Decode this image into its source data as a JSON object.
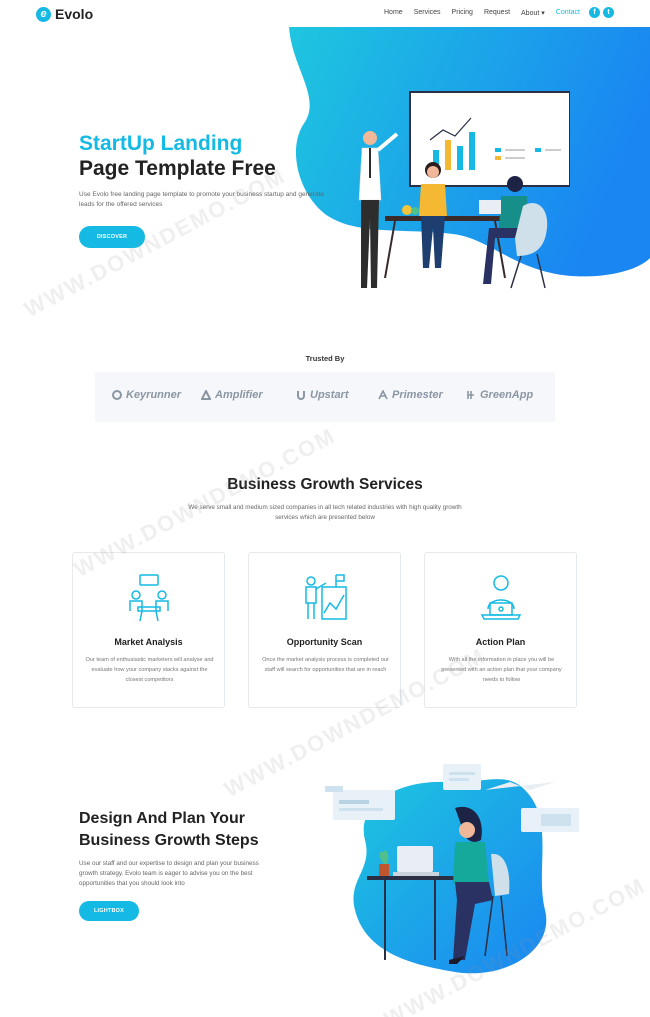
{
  "nav": {
    "logo_letter": "e",
    "brand": "Evolo",
    "items": [
      {
        "label": "Home"
      },
      {
        "label": "Services"
      },
      {
        "label": "Pricing"
      },
      {
        "label": "Request"
      },
      {
        "label": "About ▾"
      },
      {
        "label": "Contact"
      }
    ],
    "social": [
      "f",
      "t"
    ]
  },
  "hero": {
    "title_line1": "StartUp Landing",
    "title_line2": "Page Template Free",
    "description": "Use Evolo free landing page template to promote your business startup and generate leads for the offered services",
    "button": "DISCOVER"
  },
  "trusted": {
    "title": "Trusted By",
    "brands": [
      "Keyrunner",
      "Amplifier",
      "Upstart",
      "Primester",
      "GreenApp"
    ]
  },
  "services": {
    "title": "Business Growth Services",
    "description": "We serve small and medium sized companies in all tech related industries with high quality growth services which are presented below",
    "cards": [
      {
        "title": "Market Analysis",
        "text": "Our team of enthusiastic marketers will analyse and evaluate how your company stacks against the closest competitors"
      },
      {
        "title": "Opportunity Scan",
        "text": "Once the market analysis process is completed our staff will search for opportunities that are in reach"
      },
      {
        "title": "Action Plan",
        "text": "With all the information in place you will be presented with an action plan that your company needs to follow"
      }
    ]
  },
  "design": {
    "title": "Design And Plan Your Business Growth Steps",
    "description": "Use our staff and our expertise to design and plan your business growth strategy. Evolo team is eager to advise you on the best opportunities that you should look into",
    "button": "LIGHTBOX"
  },
  "watermark": [
    "WWW.DOWNDEMO.COM",
    "WWW.DOWNDEMO.COM",
    "WWW.DOWNDEMO.COM",
    "WWW.DOWNDEMO.COM"
  ],
  "colors": {
    "accent": "#14bae4",
    "accent_dark": "#1a84f0"
  }
}
